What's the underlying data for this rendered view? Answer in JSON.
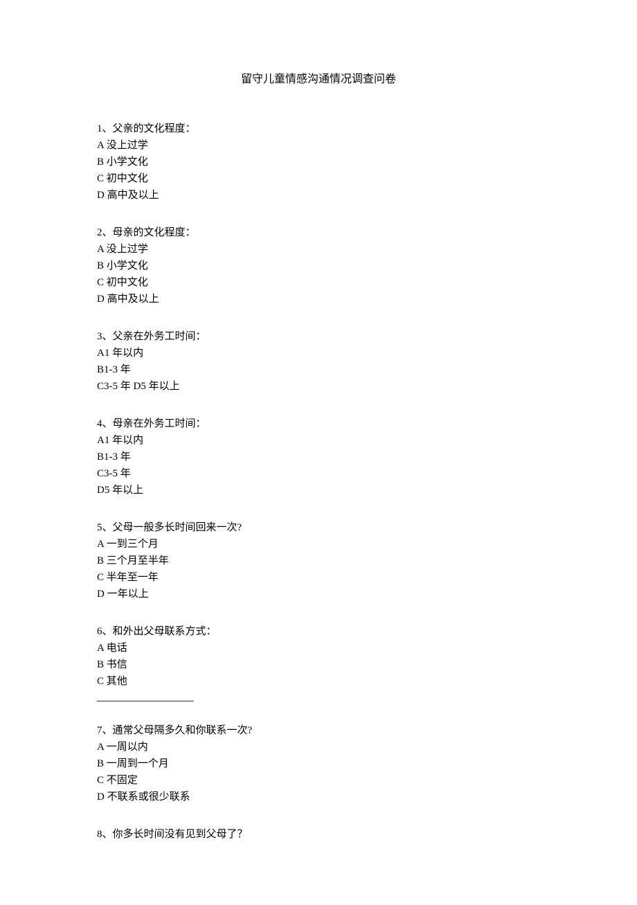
{
  "title": "留守儿童情感沟通情况调查问卷",
  "q1": {
    "text": "1、父亲的文化程度：",
    "a": "A 没上过学",
    "b": "B 小学文化",
    "c": "C 初中文化",
    "d": "D 高中及以上"
  },
  "q2": {
    "text": "2、母亲的文化程度：",
    "a": "A 没上过学",
    "b": "B 小学文化",
    "c": "C 初中文化",
    "d": "D 高中及以上"
  },
  "q3": {
    "text": "3、父亲在外务工时间：",
    "a": "A1 年以内",
    "b": "B1-3 年",
    "c": "C3-5 年 D5 年以上"
  },
  "q4": {
    "text": "  4、母亲在外务工时间：",
    "a": "A1 年以内",
    "b": "B1-3 年",
    "c": "C3-5 年",
    "d": "D5 年以上"
  },
  "q5": {
    "text": "  5、父母一般多长时间回来一次?",
    "a": "A 一到三个月",
    "b": "B 三个月至半年",
    "c": "C 半年至一年",
    "d": "D 一年以上"
  },
  "q6": {
    "text": "6、和外出父母联系方式：",
    "a": "A 电话",
    "b": "B 书信",
    "c": "C 其他"
  },
  "q7": {
    "text": "7、通常父母隔多久和你联系一次?",
    "a": "A 一周以内",
    "b": "B 一周到一个月",
    "c": "C 不固定",
    "d": "D 不联系或很少联系"
  },
  "q8": {
    "text": "  8、你多长时间没有见到父母了？"
  }
}
